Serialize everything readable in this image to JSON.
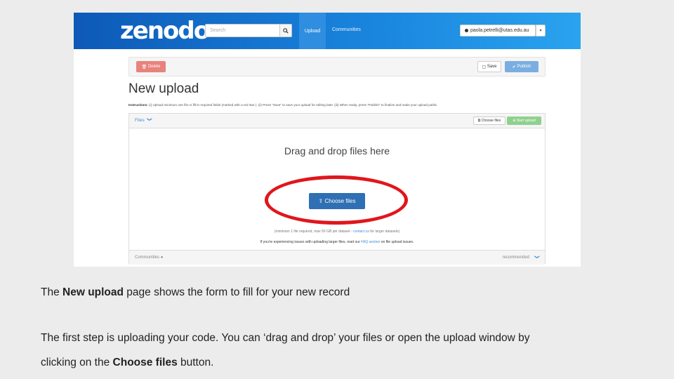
{
  "navbar": {
    "logo": "zenodo",
    "search_placeholder": "Search",
    "upload_label": "Upload",
    "communities_label": "Communities",
    "user_email": "paola.petrelli@utas.edu.au"
  },
  "actions": {
    "delete_label": "Delete",
    "save_label": "Save",
    "publish_label": "Publish"
  },
  "page": {
    "title": "New upload",
    "instructions_label": "Instructions:",
    "instructions_text": " (i) Upload minimum one file or fill-in required fields (marked with a red star ). (ii) Press \"Save\" to save your upload for editing later. (iii) When ready, press \"Publish\" to finalize and make your upload public."
  },
  "files_panel": {
    "header_label": "Files",
    "choose_files_small": "Choose files",
    "start_upload": "Start upload",
    "drop_text": "Drag and drop files here",
    "choose_files_button": "Choose files",
    "hint_prefix": "(minimum 1 file required, max 50 GB per dataset - ",
    "hint_link": "contact us",
    "hint_suffix": " for larger datasets)",
    "issues_prefix": "If you're experiencing issues with uploading larger files, read our ",
    "issues_link": "FAQ section",
    "issues_suffix": " on file upload issues."
  },
  "communities_panel": {
    "label": "Communities",
    "recommended": "recommended"
  },
  "caption": {
    "line1_pre": "The ",
    "line1_bold": "New upload",
    "line1_post": " page shows the form to fill for your new record",
    "line2": "The first step is uploading your code. You can ‘drag and drop’ your files or open the upload window by",
    "line3_pre": "clicking on the ",
    "line3_bold": "Choose files",
    "line3_post": " button."
  },
  "colors": {
    "navbar_start": "#0d59b7",
    "navbar_end": "#2aa3ee",
    "highlight_ellipse": "#e0161c",
    "primary_button": "#2f6fb3"
  }
}
